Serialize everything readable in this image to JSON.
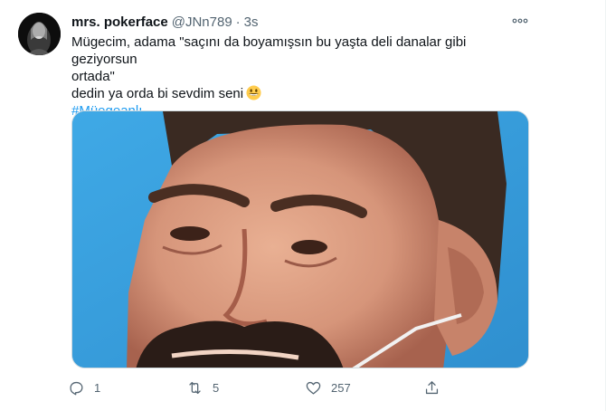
{
  "tweet": {
    "display_name": "mrs. pokerface",
    "handle": "@JNn789",
    "separator": "·",
    "time": "3s",
    "text_lines": [
      "Mügecim, adama \"saçını da boyamışsın bu yaşta deli danalar gibi geziyorsun",
      "ortada\"",
      "dedin ya orda bi sevdim seni"
    ],
    "emoji": "grinning-face",
    "hashtag": "#Müegeanlı",
    "media": {
      "description_icon": "photo"
    },
    "actions": {
      "reply_count": "1",
      "retweet_count": "5",
      "like_count": "257"
    }
  },
  "colors": {
    "accent": "#1d9bf0",
    "secondary_text": "#536471",
    "primary_text": "#0f1419",
    "photo_background": "#3aa3e0"
  }
}
